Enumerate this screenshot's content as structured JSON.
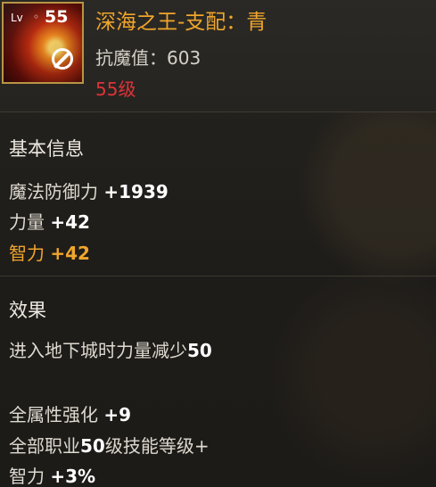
{
  "item": {
    "level_prefix": "Lv",
    "level_separator": "◦",
    "level": "55",
    "icon_badge": "no-entry-icon",
    "name": "深海之王-支配：青",
    "magic_resist": "抗魔值：603",
    "level_requirement": "55级"
  },
  "basic_info": {
    "title": "基本信息",
    "stats": [
      {
        "label": "魔法防御力 ",
        "value": "+1939"
      },
      {
        "label": "力量 ",
        "value": "+42"
      },
      {
        "label": "智力 ",
        "value": "+42",
        "highlight": true
      }
    ]
  },
  "effects": {
    "title": "效果",
    "line1_text": "进入地下城时力量减少",
    "line1_value": "50",
    "extra": [
      {
        "label": "全属性强化 ",
        "value": "+9"
      },
      {
        "label_prefix": "全部职业",
        "value": "50",
        "label_suffix": "级技能等级+"
      },
      {
        "label": "智力 ",
        "value": "+3%"
      }
    ]
  },
  "colors": {
    "name": "#f0a52c",
    "level_requirement": "#e0323a",
    "highlight_stat": "#f0a52c",
    "frame": "#b89545"
  }
}
